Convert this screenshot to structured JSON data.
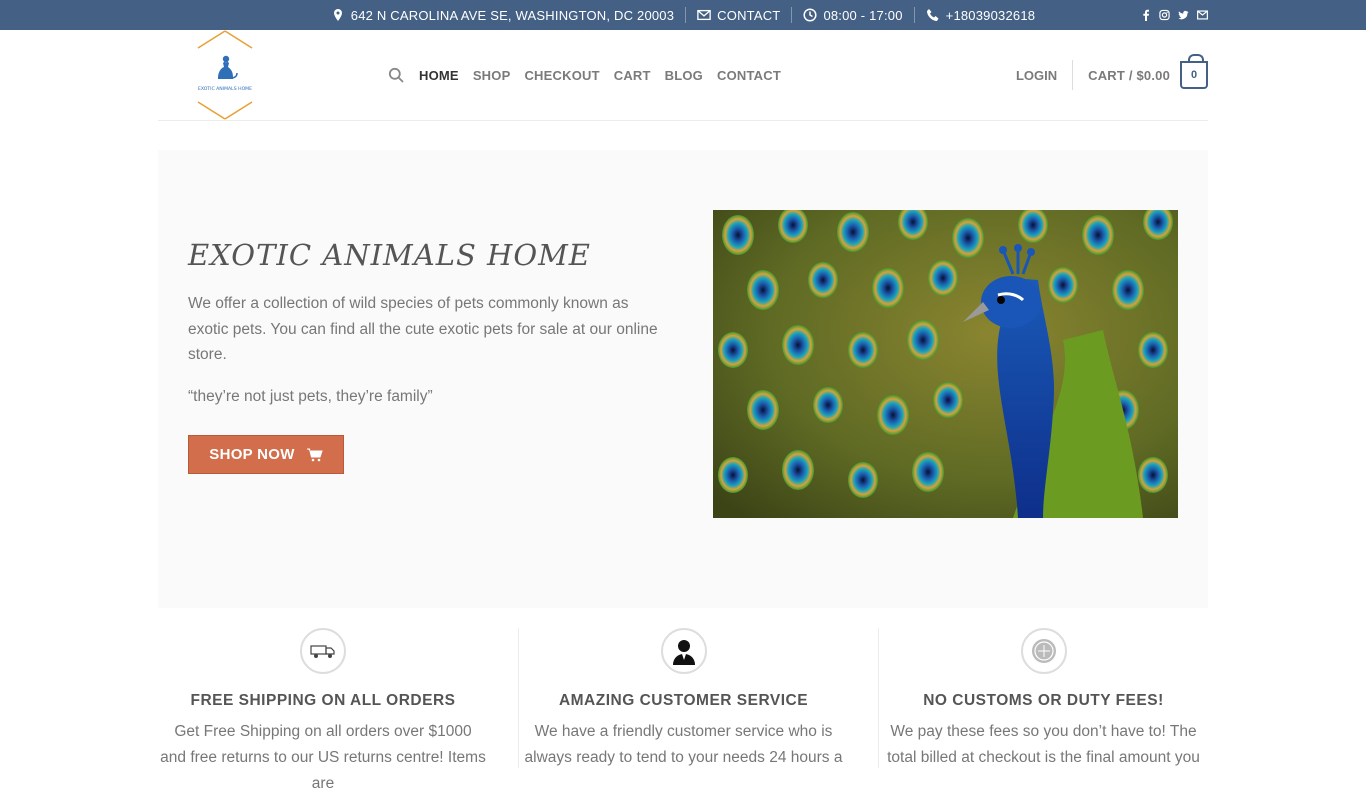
{
  "topbar": {
    "address": "642 N CAROLINA AVE SE, WASHINGTON, DC 20003",
    "contact": "CONTACT",
    "hours": "08:00 - 17:00",
    "phone": "+18039032618",
    "social": [
      "facebook-icon",
      "instagram-icon",
      "twitter-icon",
      "email-icon"
    ]
  },
  "header": {
    "logo_text": "EXOTIC ANIMALS HOME",
    "nav": [
      "HOME",
      "SHOP",
      "CHECKOUT",
      "CART",
      "BLOG",
      "CONTACT"
    ],
    "login": "LOGIN",
    "cart_label": "CART / $0.00",
    "cart_count": "0"
  },
  "hero": {
    "title": "EXOTIC ANIMALS HOME",
    "text": "We offer a collection of wild species of pets commonly known as exotic pets. You can find all the cute exotic pets for sale at our online store.",
    "quote": "“they’re not just pets, they’re family”",
    "button": "SHOP NOW"
  },
  "features": [
    {
      "icon": "delivery-truck-icon",
      "title": "FREE SHIPPING ON ALL ORDERS",
      "text": "Get Free Shipping on all orders over $1000 and free returns to our US returns centre! Items are"
    },
    {
      "icon": "customer-service-icon",
      "title": "AMAZING CUSTOMER SERVICE",
      "text": "We have a friendly customer service who is always ready to tend to your needs 24 hours a"
    },
    {
      "icon": "duty-free-badge-icon",
      "title": "NO CUSTOMS OR DUTY FEES!",
      "text": "We pay these fees so you don’t have to! The total billed at checkout is the final amount you"
    }
  ],
  "colors": {
    "topbar": "#446084",
    "button": "#d26e4b",
    "cart_border": "#446084"
  }
}
